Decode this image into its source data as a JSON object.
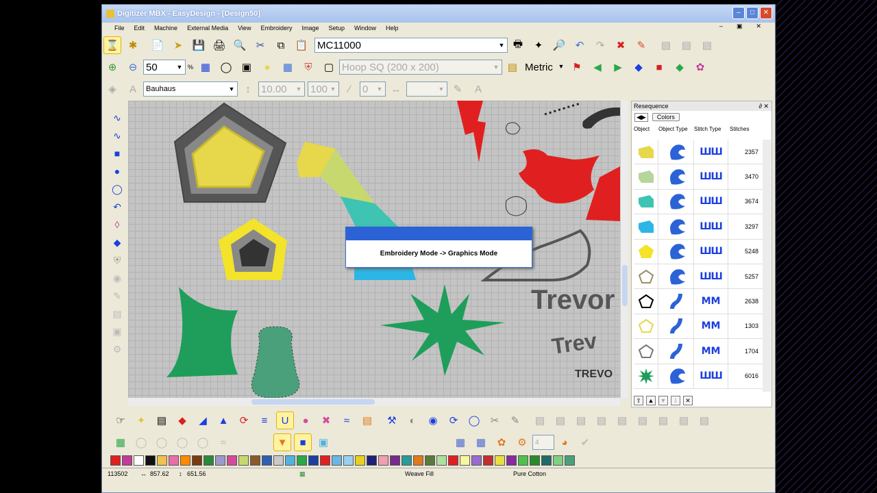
{
  "window": {
    "title": "Digitizer MBX - EasyDesign - [Design50]"
  },
  "menu": [
    "File",
    "Edit",
    "Machine",
    "External Media",
    "View",
    "Embroidery",
    "Image",
    "Setup",
    "Window",
    "Help"
  ],
  "toolbar1": {
    "machine": "MC11000"
  },
  "toolbar2": {
    "zoom": "50",
    "zoom_unit": "%",
    "hoop": "Hoop SQ (200 x 200)",
    "units": "Metric"
  },
  "toolbar3": {
    "font": "Bauhaus",
    "height": "10.00",
    "width": "100",
    "slant": "0"
  },
  "dialog": {
    "message": "Embroidery Mode -> Graphics Mode"
  },
  "canvas": {
    "text1": "Trevor",
    "text2": "Trev",
    "text3": "Trevor",
    "text4": "TREVO"
  },
  "resequence": {
    "title": "Resequence",
    "colors_button": "Colors",
    "columns": [
      "Object",
      "Object Type",
      "Stitch Type",
      "Stitches"
    ],
    "rows": [
      {
        "shape": "ribbon",
        "color": "#e6d84a",
        "stitches": "2357"
      },
      {
        "shape": "ribbon",
        "color": "#b7d49b",
        "stitches": "3470"
      },
      {
        "shape": "ribbon",
        "color": "#3fc3b2",
        "stitches": "3674"
      },
      {
        "shape": "ribbon",
        "color": "#2bb6e6",
        "stitches": "3297"
      },
      {
        "shape": "pentagon-fill",
        "color": "#f3e32a",
        "stitches": "5248"
      },
      {
        "shape": "pentagon-outline",
        "color": "#9a8f63",
        "stitches": "5257"
      },
      {
        "shape": "pentagon-outline",
        "color": "#000000",
        "stitches": "2638"
      },
      {
        "shape": "pentagon-outline",
        "color": "#e6d84a",
        "stitches": "1303"
      },
      {
        "shape": "pentagon-outline",
        "color": "#777777",
        "stitches": "1704"
      },
      {
        "shape": "starburst",
        "color": "#1e9e5a",
        "stitches": "6016"
      }
    ]
  },
  "status": {
    "stitches": "113502",
    "width": "857.62",
    "height": "651.56",
    "fill": "Weave Fill",
    "thread": "Pure Cotton"
  },
  "palette": [
    "#e02020",
    "#c33a9a",
    "#ffffff",
    "#111111",
    "#f2c14e",
    "#e86fa5",
    "#ff8a00",
    "#7a3b10",
    "#2a8a3a",
    "#9a9acd",
    "#d44b9c",
    "#c7d96e",
    "#8a5a2a",
    "#2f5fb0",
    "#c9c9c9",
    "#4fb3e0",
    "#2aa84a",
    "#1f3fa0",
    "#e02020",
    "#6bb6e6",
    "#9ad0f0",
    "#e8d020",
    "#20207a",
    "#f0a0b0",
    "#7a2a8a",
    "#2a9a9a",
    "#e07a1f",
    "#5a7a3a",
    "#b0e0a0",
    "#e02020",
    "#f7f7a0",
    "#9a6ad0",
    "#c03030",
    "#e8e040",
    "#8a2aa0",
    "#50c050",
    "#2a8a2a",
    "#206a6a",
    "#80d080",
    "#4aa07a"
  ]
}
